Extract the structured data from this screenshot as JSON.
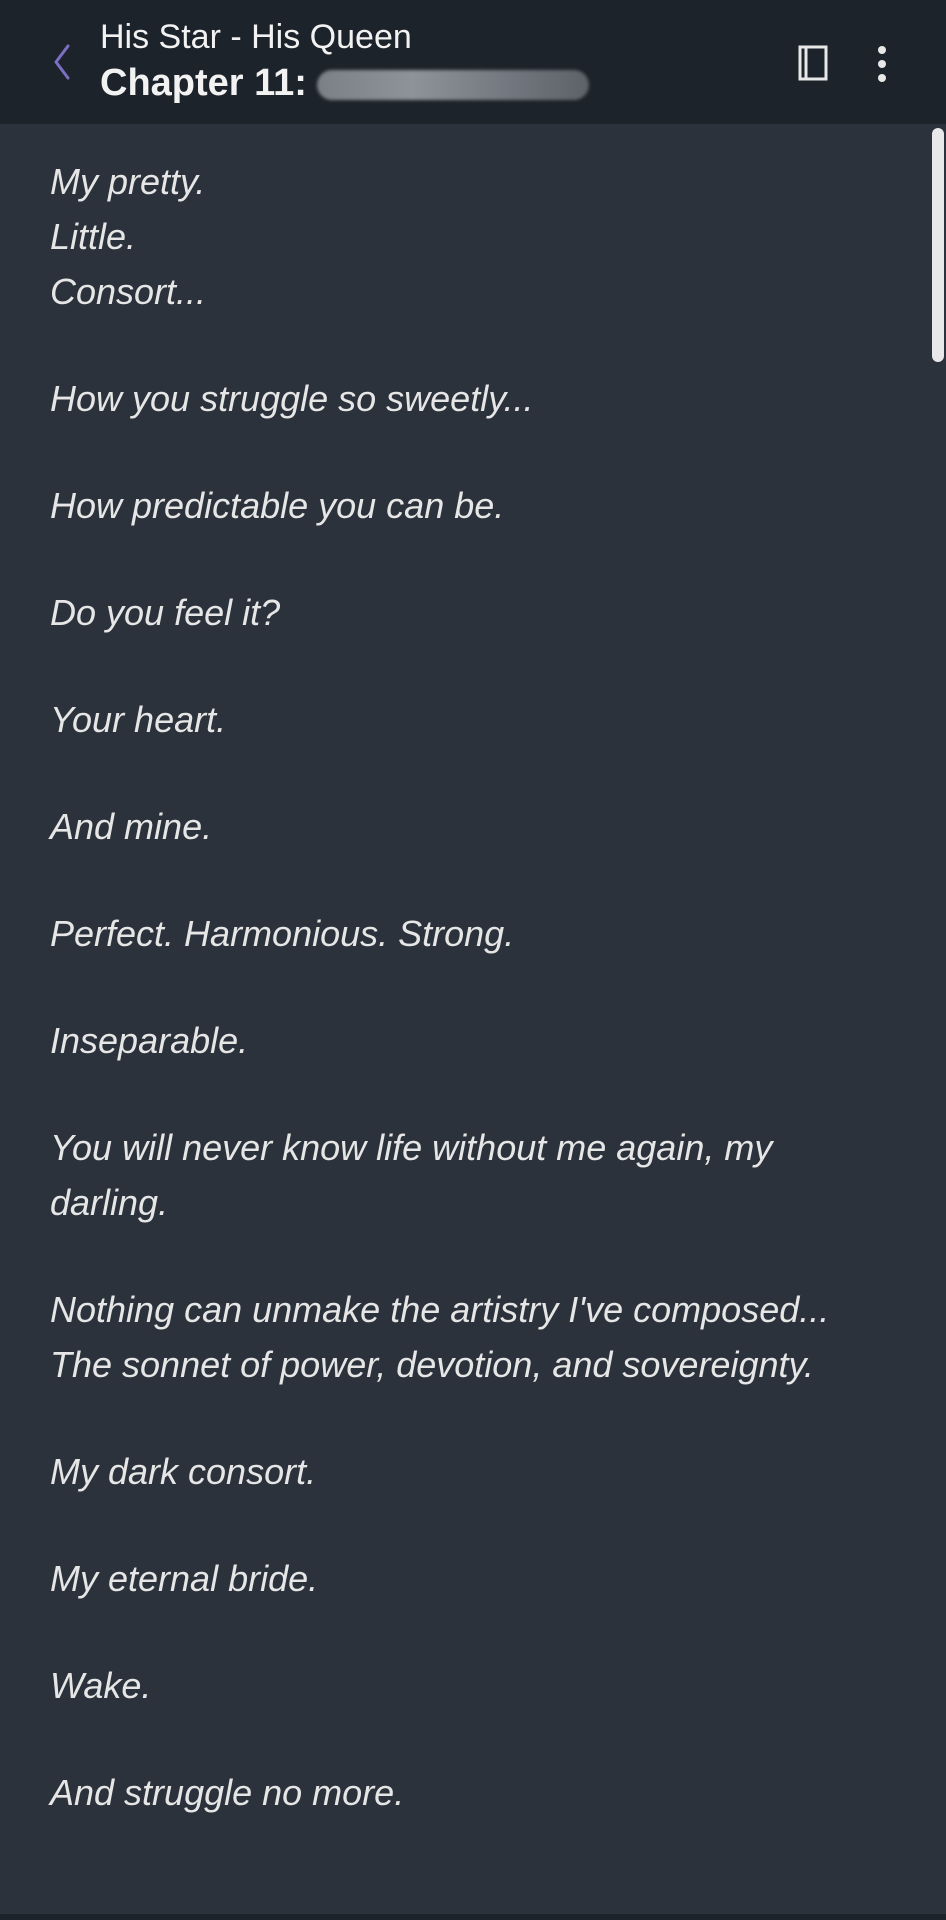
{
  "header": {
    "back_icon": "chevron-left-icon",
    "story_title": "His Star - His Queen",
    "chapter_title": "Chapter 11:",
    "toc_icon": "book-icon",
    "menu_icon": "more-vertical-icon",
    "accent_color": "#7b6fc4"
  },
  "content": {
    "paragraphs": [
      "My pretty.",
      "Little.",
      "Consort...",
      "How you struggle so sweetly...",
      "How predictable you can be.",
      "Do you feel it?",
      "Your heart.",
      "And mine.",
      "Perfect. Harmonious. Strong.",
      "Inseparable.",
      "You will never know life without me again, my darling.",
      "Nothing can unmake the artistry I've composed... The sonnet of power, devotion, and sovereignty.",
      "My dark consort.",
      "My eternal bride.",
      "Wake.",
      "And struggle no more."
    ]
  },
  "colors": {
    "background": "#2b323b",
    "header_background": "#1d232a",
    "text": "#e6e6e6"
  }
}
